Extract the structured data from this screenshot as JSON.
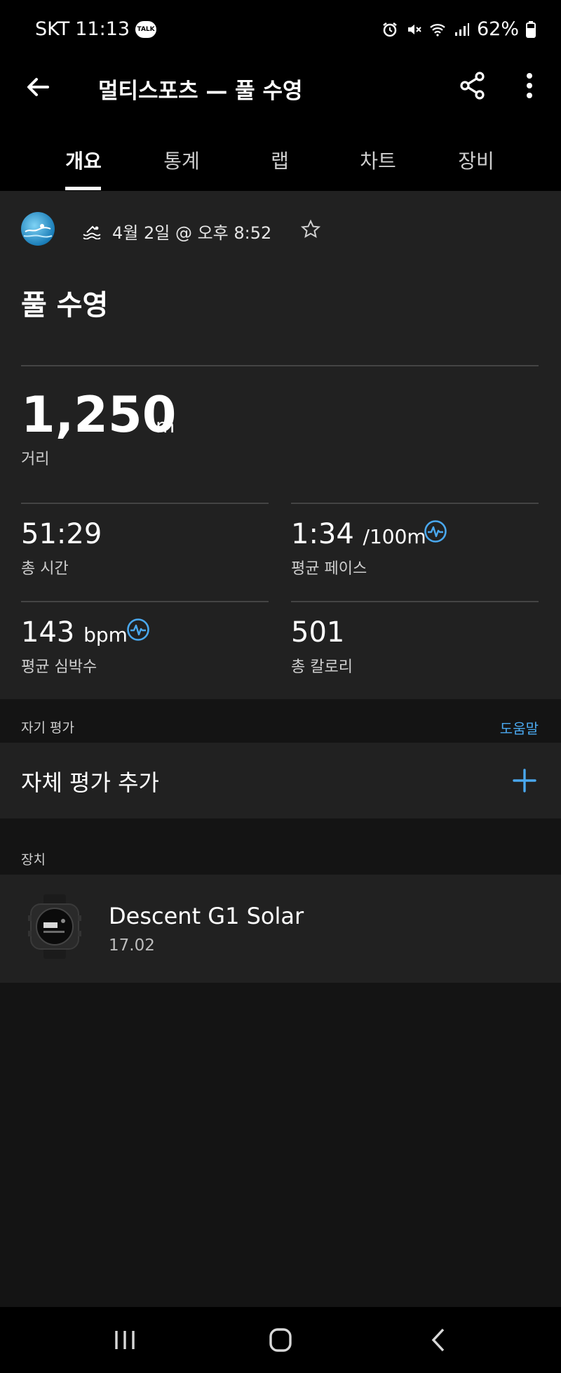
{
  "status_bar": {
    "carrier": "SKT",
    "time": "11:13",
    "talk_badge": "TALK",
    "battery": "62%"
  },
  "app_bar": {
    "title": "멀티스포츠 — 풀 수영"
  },
  "tabs": [
    {
      "label": "개요",
      "active": true
    },
    {
      "label": "통계",
      "active": false
    },
    {
      "label": "랩",
      "active": false
    },
    {
      "label": "차트",
      "active": false
    },
    {
      "label": "장비",
      "active": false
    }
  ],
  "activity": {
    "date": "4월 2일 @ 오후 8:52",
    "title": "풀 수영",
    "distance": {
      "value": "1,250",
      "unit": "m",
      "label": "거리"
    },
    "total_time": {
      "value": "51:29",
      "label": "총 시간"
    },
    "avg_pace": {
      "value": "1:34",
      "unit": "/100m",
      "label": "평균 페이스"
    },
    "avg_hr": {
      "value": "143",
      "unit": "bpm",
      "label": "평균 심박수"
    },
    "calories": {
      "value": "501",
      "label": "총 칼로리"
    }
  },
  "self_eval": {
    "section_label": "자기 평가",
    "help": "도움말",
    "add_label": "자체 평가 추가"
  },
  "device": {
    "section_label": "장치",
    "name": "Descent G1 Solar",
    "version": "17.02"
  },
  "colors": {
    "accent": "#4aa8ee",
    "card": "#212121",
    "background": "#141414"
  }
}
